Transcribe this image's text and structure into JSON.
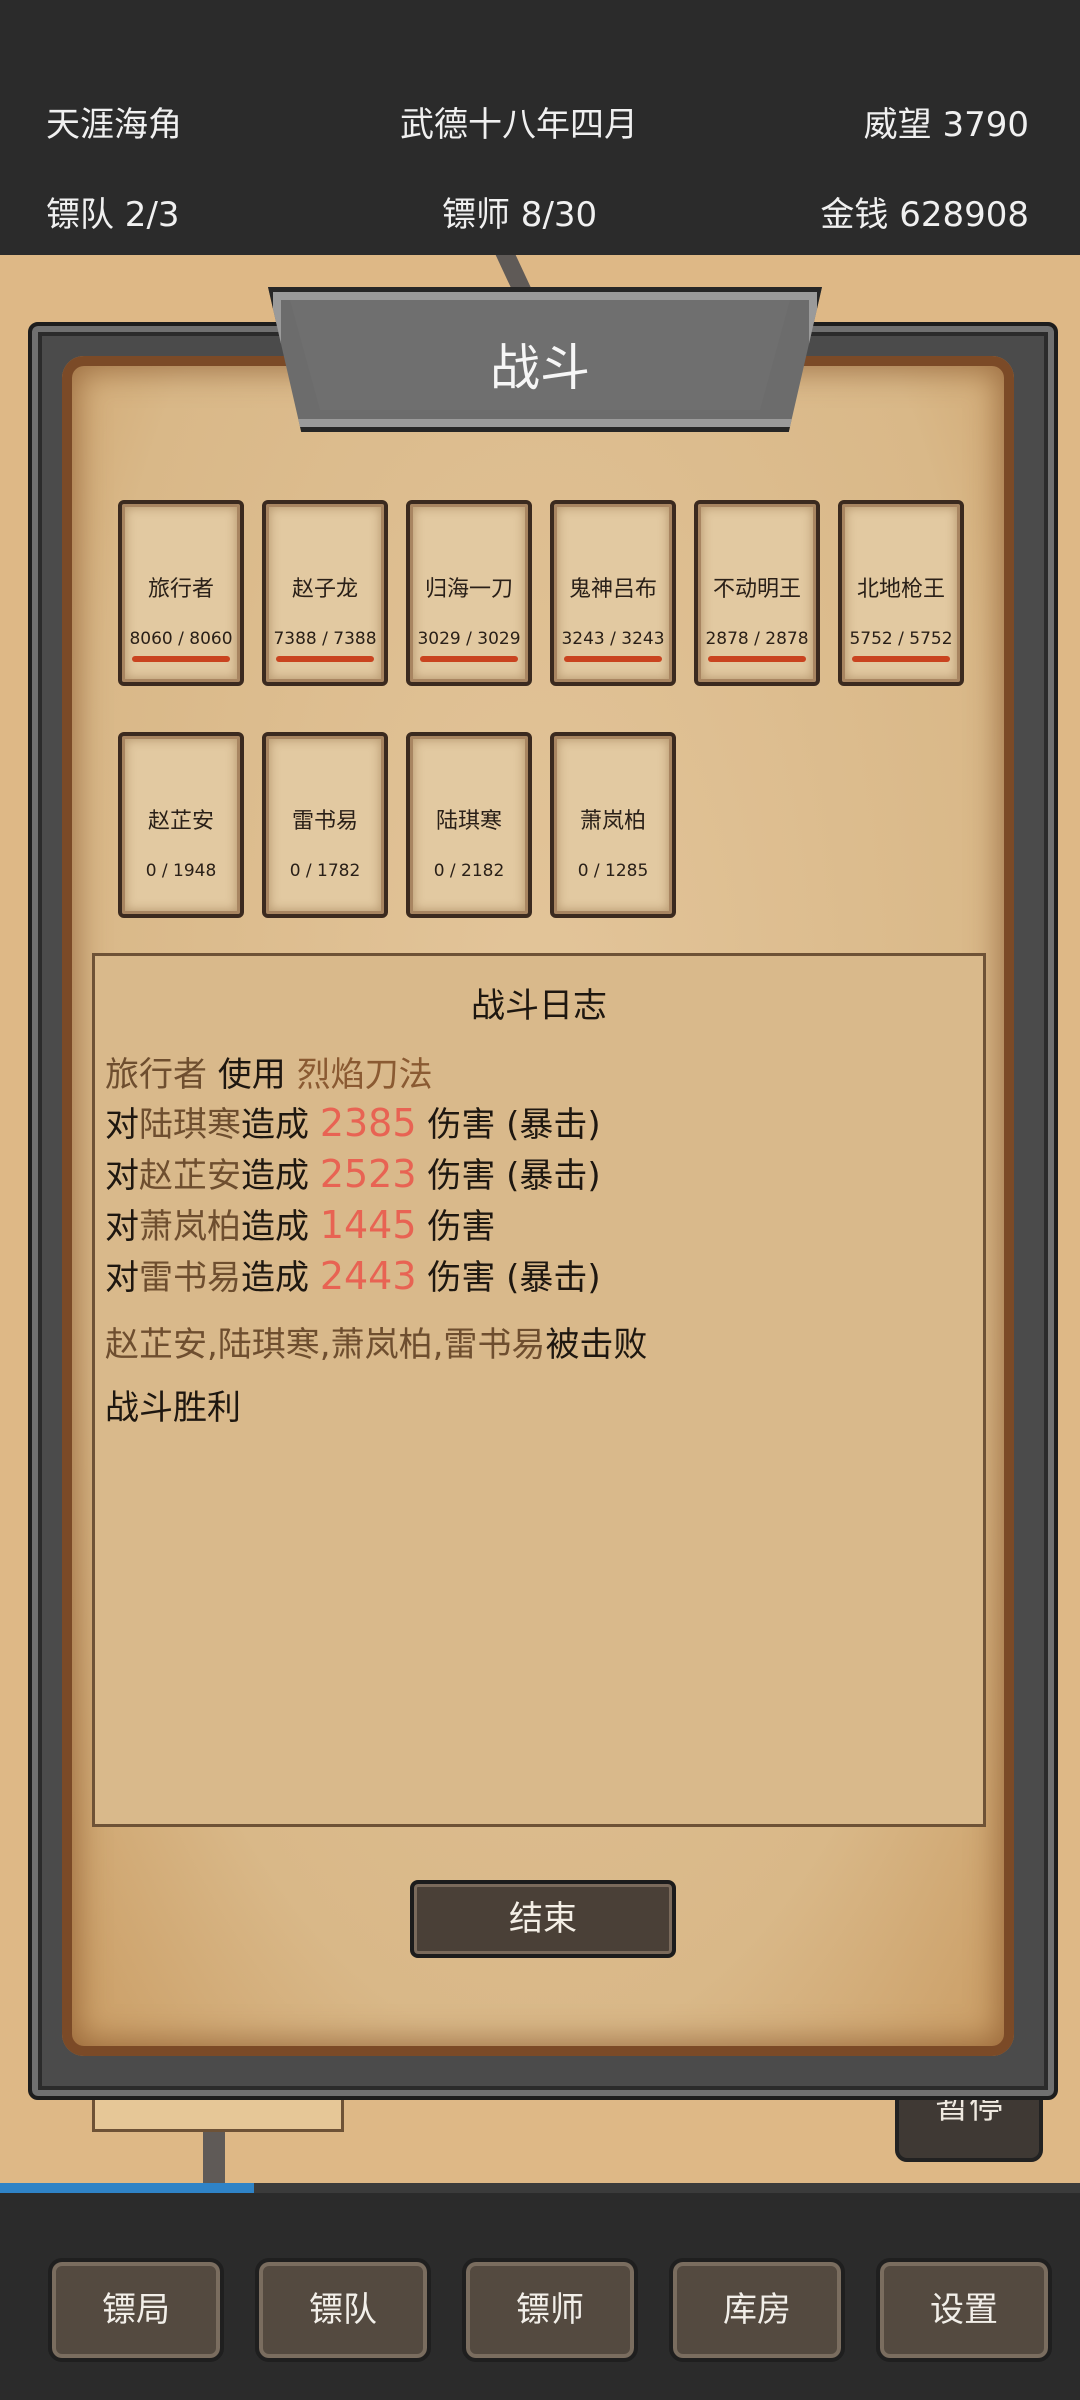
{
  "header": {
    "location": "天涯海角",
    "date": "武德十八年四月",
    "prestige": "威望 3790",
    "team": "镖队 2/3",
    "escorts": "镖师 8/30",
    "money": "金钱  628908"
  },
  "dialog": {
    "title": "战斗",
    "allies": [
      {
        "name": "旅行者",
        "hp": "8060 / 8060",
        "hp_fraction": 1.0
      },
      {
        "name": "赵子龙",
        "hp": "7388 / 7388",
        "hp_fraction": 1.0
      },
      {
        "name": "归海一刀",
        "hp": "3029 / 3029",
        "hp_fraction": 1.0
      },
      {
        "name": "鬼神吕布",
        "hp": "3243 / 3243",
        "hp_fraction": 1.0
      },
      {
        "name": "不动明王",
        "hp": "2878 / 2878",
        "hp_fraction": 1.0
      },
      {
        "name": "北地枪王",
        "hp": "5752 / 5752",
        "hp_fraction": 1.0
      }
    ],
    "enemies": [
      {
        "name": "赵芷安",
        "hp": "0 / 1948",
        "hp_fraction": 0
      },
      {
        "name": "雷书易",
        "hp": "0 / 1782",
        "hp_fraction": 0
      },
      {
        "name": "陆琪寒",
        "hp": "0 / 2182",
        "hp_fraction": 0
      },
      {
        "name": "萧岚柏",
        "hp": "0 / 1285",
        "hp_fraction": 0
      }
    ],
    "log": {
      "title": "战斗日志",
      "actor": "旅行者",
      "use": " 使用 ",
      "skill": "烈焰刀法",
      "hit_prefix": "对",
      "hit_verb": "造成 ",
      "dmg_word": " 伤害",
      "crit": " (暴击)",
      "hits": [
        {
          "target": "陆琪寒",
          "damage": "2385",
          "crit": true
        },
        {
          "target": "赵芷安",
          "damage": "2523",
          "crit": true
        },
        {
          "target": "萧岚柏",
          "damage": "1445",
          "crit": false
        },
        {
          "target": "雷书易",
          "damage": "2443",
          "crit": true
        }
      ],
      "defeated_names": "赵芷安,陆琪寒,萧岚柏,雷书易",
      "defeated_suffix": "被击败",
      "result": "战斗胜利"
    },
    "end_button": "结束"
  },
  "background": {
    "pause_button": "暂停",
    "progress": 0.235
  },
  "nav": [
    "镖局",
    "镖队",
    "镖师",
    "库房",
    "设置"
  ],
  "colors": {
    "damage": "#e86353",
    "hp_bar": "#c9431f",
    "progress": "#2f83c7"
  }
}
